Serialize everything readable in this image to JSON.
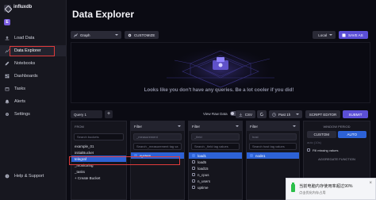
{
  "app": {
    "brand": "influxdb",
    "org_sub": "",
    "org_initial": "E",
    "org_name": ""
  },
  "sidebar": {
    "items": [
      {
        "label": "Load Data",
        "icon": "upload-icon"
      },
      {
        "label": "Data Explorer",
        "icon": "graph-icon",
        "active": true
      },
      {
        "label": "Notebooks",
        "icon": "pencil-icon"
      },
      {
        "label": "Dashboards",
        "icon": "dashboard-icon"
      },
      {
        "label": "Tasks",
        "icon": "calendar-icon"
      },
      {
        "label": "Alerts",
        "icon": "bell-icon"
      },
      {
        "label": "Settings",
        "icon": "gear-icon"
      },
      {
        "label": "Help & Support",
        "icon": "help-icon"
      }
    ]
  },
  "header": {
    "title": "Data Explorer"
  },
  "toolbar": {
    "graph_type": "Graph",
    "customize": "CUSTOMIZE",
    "timezone": "Local",
    "save_as": "SAVE AS"
  },
  "graph": {
    "empty_message": "Looks like you don't have any queries. Be a lot cooler if you did!"
  },
  "query_bar": {
    "tab": "Query 1",
    "add": "+",
    "view_raw": "View Raw Data",
    "csv": "CSV",
    "time_range": "Past 1h",
    "script_editor": "SCRIPT EDITOR",
    "submit": "SUBMIT"
  },
  "builder": {
    "from": {
      "label": "FROM",
      "search_placeholder": "Search buckets",
      "buckets": [
        "example_01",
        "initialBucket",
        "telegraf",
        "_monitoring",
        "_tasks",
        "+ Create Bucket"
      ],
      "selected": "telegraf"
    },
    "filter1": {
      "head": "Filter",
      "key": "_measurement",
      "search_placeholder": "Search _measurement tag va",
      "items": [
        "system"
      ]
    },
    "filter2": {
      "head": "Filter",
      "key": "_field",
      "search_placeholder": "Search _field tag values",
      "items": [
        "load1",
        "load5",
        "load15",
        "n_cpus",
        "n_users",
        "uptime"
      ]
    },
    "filter3": {
      "head": "Filter",
      "key": "host",
      "search_placeholder": "Search host tag values",
      "items": [
        "node1"
      ]
    },
    "window": {
      "label": "WINDOW PERIOD",
      "custom": "CUSTOM",
      "auto": "AUTO",
      "auto_value": "auto (10s)",
      "fill_missing": "Fill missing values",
      "agg_label": "AGGREGATE FUNCTION"
    }
  },
  "toast": {
    "title": "当前电脑内存使用率超过90%",
    "sub": "点击优化内存占用",
    "close": "×"
  },
  "colors": {
    "accent": "#5b4fd6",
    "selected": "#2d62d6",
    "annotation": "#e03b3b"
  }
}
